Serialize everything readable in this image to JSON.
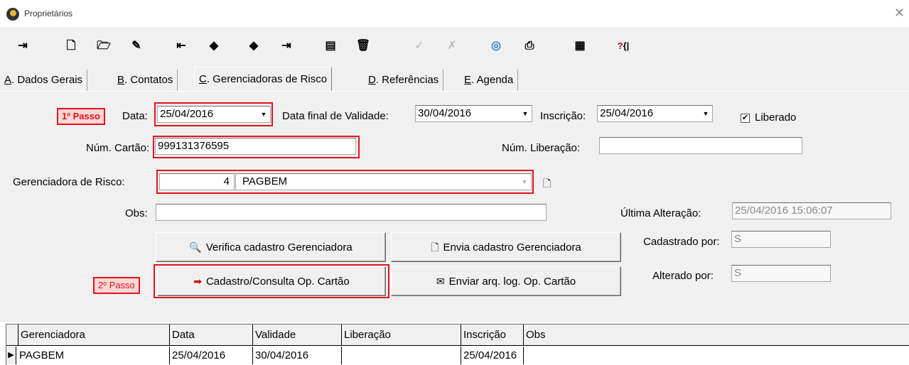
{
  "window": {
    "title": "Proprietários"
  },
  "toolbar": {
    "icons": [
      "exit-icon",
      "new-icon",
      "open-icon",
      "edit-icon",
      "first-icon",
      "prev-icon",
      "next-icon",
      "last-icon",
      "search-icon",
      "delete-icon",
      "confirm-icon",
      "cancel-icon",
      "preview-icon",
      "print-icon",
      "calculator-icon",
      "help-icon"
    ]
  },
  "tabs": [
    {
      "key": "A",
      "label": ". Dados Gerais"
    },
    {
      "key": "B",
      "label": ". Contatos"
    },
    {
      "key": "C",
      "label": ". Gerenciadoras de Risco"
    },
    {
      "key": "D",
      "label": ". Referências"
    },
    {
      "key": "E",
      "label": ". Agenda"
    }
  ],
  "form": {
    "step1": "1º Passo",
    "step2": "2º Passo",
    "data_label": "Data:",
    "data_value": "25/04/2016",
    "data_final_label": "Data final de Validade:",
    "data_final_value": "30/04/2016",
    "inscricao_label": "Inscrição:",
    "inscricao_value": "25/04/2016",
    "liberado_label": "Liberado",
    "liberado_checked": true,
    "num_cartao_label": "Núm. Cartão:",
    "num_cartao_value": "999131376595",
    "num_liberacao_label": "Núm. Liberação:",
    "num_liberacao_value": "",
    "gerenciadora_label": "Gerenciadora de Risco:",
    "gerenciadora_code": "4",
    "gerenciadora_name": "PAGBEM",
    "obs_label": "Obs:",
    "obs_value": "",
    "ultima_alteracao_label": "Última Alteração:",
    "ultima_alteracao_value": "25/04/2016 15:06:07",
    "cadastrado_por_label": "Cadastrado por:",
    "cadastrado_por_value": "S",
    "alterado_por_label": "Alterado por:",
    "alterado_por_value": "S"
  },
  "buttons": {
    "verifica": "Verifica cadastro Gerenciadora",
    "envia": "Envia cadastro Gerenciadora",
    "cadastro_consulta": "Cadastro/Consulta Op. Cartão",
    "enviar_log": "Enviar arq. log. Op. Cartão"
  },
  "grid": {
    "headers": [
      "Gerenciadora",
      "Data",
      "Validade",
      "Liberação",
      "Inscrição",
      "Obs"
    ],
    "rows": [
      [
        "PAGBEM",
        "25/04/2016",
        "30/04/2016",
        "",
        "25/04/2016",
        ""
      ]
    ]
  }
}
